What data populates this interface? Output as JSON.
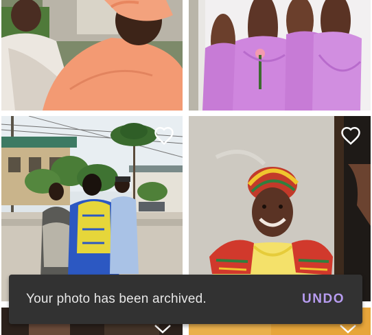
{
  "snackbar": {
    "message": "Your photo has been archived.",
    "action_label": "UNDO"
  },
  "colors": {
    "snackbar_bg": "#323232",
    "action": "#b79cf0",
    "heart": "#ffffff"
  },
  "icons": {
    "favorite": "heart-outline-icon",
    "scroll_hint": "chevron-down-icon"
  }
}
